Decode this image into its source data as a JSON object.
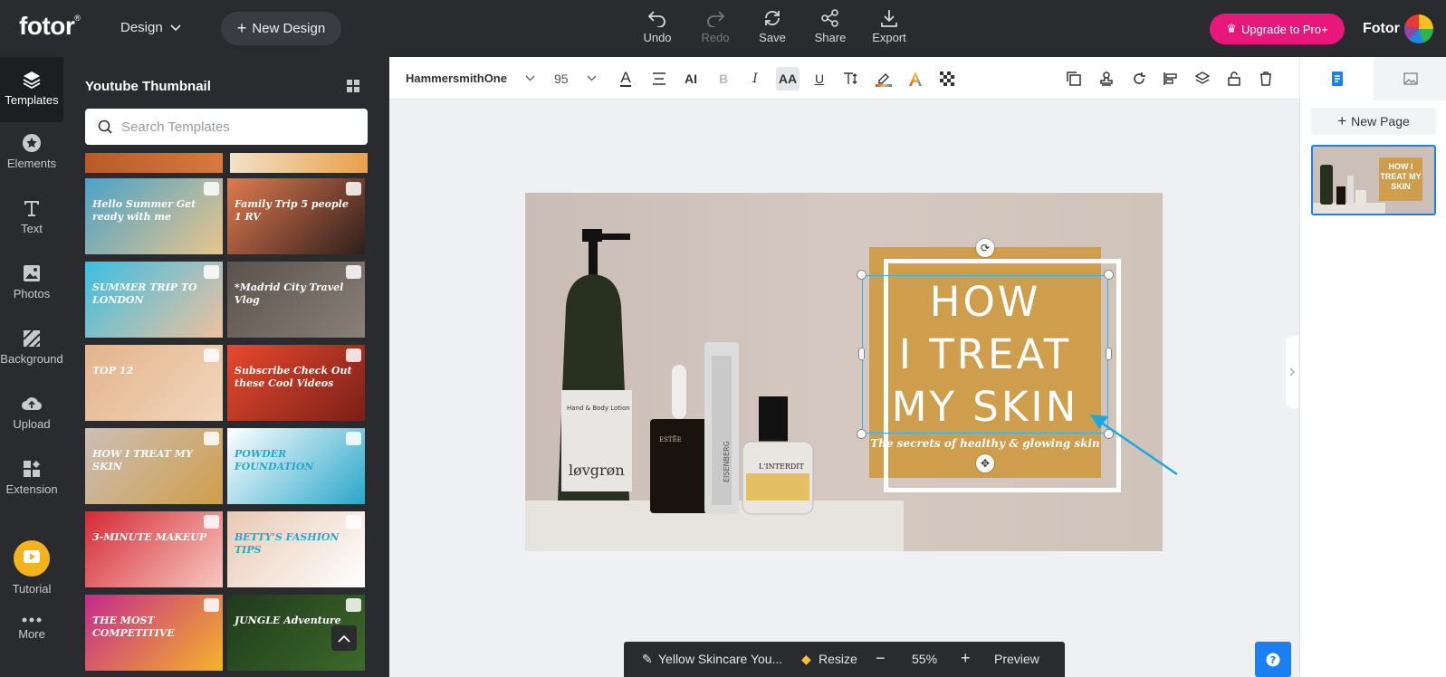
{
  "app": {
    "logo": "fotor",
    "design_menu": "Design",
    "new_design": "New Design",
    "toolbar": {
      "undo": "Undo",
      "redo": "Redo",
      "save": "Save",
      "share": "Share",
      "export": "Export"
    },
    "upgrade": "Upgrade to Pro+",
    "user": "Fotor"
  },
  "rail": {
    "items": [
      {
        "label": "Templates"
      },
      {
        "label": "Elements"
      },
      {
        "label": "Text"
      },
      {
        "label": "Photos"
      },
      {
        "label": "Background"
      },
      {
        "label": "Upload"
      },
      {
        "label": "Extension"
      },
      {
        "label": "Tutorial"
      },
      {
        "label": "More"
      }
    ]
  },
  "panel": {
    "title": "Youtube Thumbnail",
    "search_placeholder": "Search Templates",
    "thumbs": [
      {
        "text": "Hello Summer  Get ready with me",
        "colors": [
          "#4aa3c9",
          "#e9c48c"
        ]
      },
      {
        "text": "Family Trip  5 people 1 RV",
        "colors": [
          "#e07a4f",
          "#2e1e1a"
        ]
      },
      {
        "text": "SUMMER TRIP TO LONDON",
        "colors": [
          "#3bbfe2",
          "#f0c0a0"
        ]
      },
      {
        "text": "*Madrid City Travel Vlog",
        "colors": [
          "#5a524c",
          "#8a8078"
        ]
      },
      {
        "text": "TOP 12",
        "colors": [
          "#e3b48c",
          "#f2d6bd"
        ]
      },
      {
        "text": "Subscribe  Check Out these Cool Videos",
        "colors": [
          "#e8492d",
          "#7a1f18"
        ]
      },
      {
        "text": "HOW I TREAT MY SKIN",
        "colors": [
          "#cbbfb7",
          "#cf9e4c"
        ]
      },
      {
        "text": "POWDER FOUNDATION",
        "colors": [
          "#ffffff",
          "#29a7c9"
        ]
      },
      {
        "text": "3-MINUTE MAKEUP",
        "colors": [
          "#d62a35",
          "#f7c9c2"
        ]
      },
      {
        "text": "BETTY'S FASHION TIPS",
        "colors": [
          "#e9c9b4",
          "#ffffff"
        ]
      },
      {
        "text": "THE MOST COMPETITIVE",
        "colors": [
          "#c42a8c",
          "#f3b42a"
        ]
      },
      {
        "text": "JUNGLE Adventure",
        "colors": [
          "#1f3a1c",
          "#3d6a2a"
        ]
      }
    ]
  },
  "editbar": {
    "font": "HammersmithOne",
    "size": "95"
  },
  "design": {
    "headline": [
      "HOW",
      "I TREAT",
      "MY SKIN"
    ],
    "subtitle": "The secrets of healthy & glowing skin",
    "accent": "#cf9e4c",
    "selection_color": "#3ab0e2"
  },
  "bottom": {
    "name": "Yellow Skincare You...",
    "resize": "Resize",
    "zoom": "55%",
    "preview": "Preview"
  },
  "rpanel": {
    "new_page": "New Page",
    "thumb_text": "HOW I TREAT MY SKIN"
  }
}
